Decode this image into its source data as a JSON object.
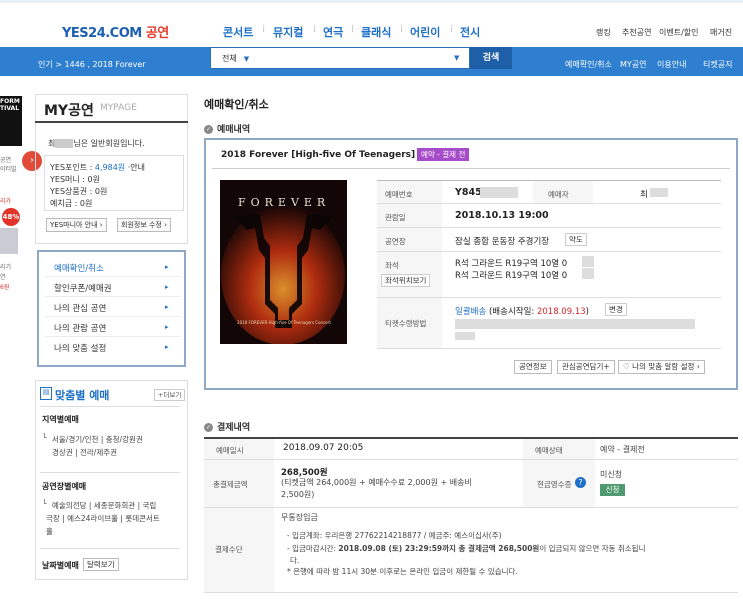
{
  "header": {
    "logo": "YES24.COM",
    "logo_suffix": "공연",
    "gnb": [
      "콘서트",
      "뮤지컬",
      "연극",
      "클래식",
      "어린이",
      "전시"
    ],
    "util": [
      "랭킹",
      "추천공연",
      "이벤트/할인",
      "매거진"
    ]
  },
  "subbar": {
    "breadcrumb": "인기 > 1446 , 2018 Forever",
    "search_select": "전체",
    "search_button": "검색",
    "links": [
      "예매확인/취소",
      "MY공연",
      "이용안내",
      "티켓공지"
    ]
  },
  "left_strip": {
    "banner_text": "FORM\nTIVAL",
    "texts": [
      "공연",
      "이티빌",
      "리가",
      "리기",
      "연",
      "6원"
    ],
    "badge": "48%"
  },
  "mypage": {
    "title": "MY공연",
    "title_sub": "MYPAGE",
    "greeting_prefix": "최",
    "greeting_suffix": "님은 일반회원입니다.",
    "points": [
      {
        "label": "YES포인트 : ",
        "value": "4,984원",
        "extra": " ·안내"
      },
      {
        "label": "YES머니 : ",
        "value": "0원",
        "extra": ""
      },
      {
        "label": "YES상품권 : ",
        "value": "0원",
        "extra": ""
      },
      {
        "label": "예치금 : ",
        "value": "0원",
        "extra": ""
      }
    ],
    "btn_guide": "YES마니아 안내",
    "btn_edit": "회원정보 수정"
  },
  "menu": [
    {
      "label": "예매확인/취소",
      "active": true
    },
    {
      "label": "할인쿠폰/예매권",
      "active": false
    },
    {
      "label": "나의 관심 공연",
      "active": false
    },
    {
      "label": "나의 관람 공연",
      "active": false
    },
    {
      "label": "나의 맞춤 설정",
      "active": false
    }
  ],
  "custom": {
    "title": "맞춤별 예매",
    "more": "+더보기",
    "region_title": "지역별예매",
    "region_lines": [
      "서울/경기/인천 | 충청/강원권",
      "경상권 | 전라/제주권"
    ],
    "venue_title": "공연장별예매",
    "venue_lines": [
      "예술의전당 | 세종문화회관 | 국립",
      "극장 | 예스24라이브홀 | 롯데콘서트",
      "홀"
    ],
    "date_title": "날짜별예매",
    "date_btn": "달력보기"
  },
  "main": {
    "page_title": "예매확인/취소",
    "resv_section": "예매내역",
    "show_title": "2018 Forever [High-five Of Teenagers] ..",
    "status": "예약 - 결제 전",
    "poster_title": "FOREVER",
    "poster_sub": "2018 FOREVER High-five Of Teenagers Concert",
    "detail": {
      "resv_no_label": "예매번호",
      "resv_no": "Y845",
      "booker_label": "예매자",
      "booker": "최",
      "date_label": "관람일",
      "date": "2018.10.13 19:00",
      "venue_label": "공연장",
      "venue": "잠실 종합 운동장 주경기장",
      "venue_btn": "약도",
      "seat_label": "좌석",
      "seat_btn": "좌석위치보기",
      "seats": [
        "R석 그라운드 R19구역 10열 0",
        "R석 그라운드 R19구역 10열 0"
      ],
      "method_label": "티켓수령방법",
      "method": "일괄배송",
      "ship_prefix": " (배송시작일: ",
      "ship_date": "2018.09.13",
      "ship_suffix": ")",
      "change_btn": "변경"
    },
    "btn_info": "공연정보",
    "btn_interest": "관심공연담기+",
    "btn_alarm": "나의 맞춤 알람 설정 ›"
  },
  "payment": {
    "section": "결제내역",
    "pay_date_label": "예매일시",
    "pay_date": "2018.09.07 20:05",
    "state_label": "예매상태",
    "state": "예약 - 결제전",
    "total_label": "총결제금액",
    "total": "268,500원",
    "total_detail_1": "(티켓금액 264,000원 + 예매수수료 2,000원 + 배송비",
    "total_detail_2": "2,500원)",
    "receipt_label": "현금영수증",
    "receipt_state": "미신청",
    "receipt_btn": "신청",
    "method_label": "결제수단",
    "method_title": "무통장입금",
    "note1": "- 입금계좌: 우리은행 27762214218877 / 예금주: 예스이십사(주)",
    "note2_prefix": "- 입금마감시간: ",
    "note2_bold": "2018.09.08 (토) 23:29:59까지 총 결제금액 268,500원",
    "note2_suffix": "이 입금되지 않으면 자동 취소됩니",
    "note2_cont": "다.",
    "note3": "* 은행에 따라 밤 11시 30분 이후로는 온라인 입금이 제한될 수 있습니다."
  }
}
